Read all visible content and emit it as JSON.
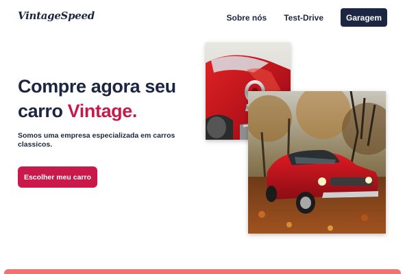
{
  "header": {
    "logo": "VintageSpeed",
    "nav": {
      "about": "Sobre nós",
      "test_drive": "Test-Drive",
      "garage": "Garagem"
    }
  },
  "hero": {
    "title_line1": "Compre agora seu",
    "title_line2": "carro",
    "title_accent": "Vintage.",
    "subtitle": "Somos uma empresa especializada em carros classicos.",
    "cta": "Escolher meu carro"
  },
  "images": {
    "photo1": "red-classic-car-taillight",
    "photo2": "red-mustang-autumn-park"
  },
  "colors": {
    "navy": "#1c2541",
    "accent": "#c9184a",
    "bottom_bar": "#f76f6f"
  }
}
